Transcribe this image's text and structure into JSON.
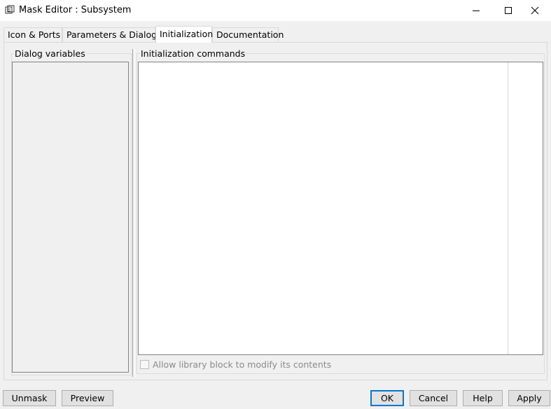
{
  "window": {
    "title": "Mask Editor : Subsystem",
    "controls": {
      "minimize": "minimize-icon",
      "maximize": "maximize-icon",
      "close": "close-icon"
    }
  },
  "tabs": [
    {
      "label": "Icon & Ports",
      "active": false
    },
    {
      "label": "Parameters & Dialog",
      "active": false
    },
    {
      "label": "Initialization",
      "active": true
    },
    {
      "label": "Documentation",
      "active": false
    }
  ],
  "panel": {
    "dialog_variables_label": "Dialog variables",
    "init_commands_label": "Initialization commands",
    "init_commands_value": "",
    "allow_library_label": "Allow library block to modify its contents",
    "allow_library_checked": false
  },
  "buttons": {
    "unmask": "Unmask",
    "preview": "Preview",
    "ok": "OK",
    "cancel": "Cancel",
    "help": "Help",
    "apply": "Apply"
  },
  "colors": {
    "accent": "#0078d7",
    "window_bg": "#f0f0f0"
  }
}
